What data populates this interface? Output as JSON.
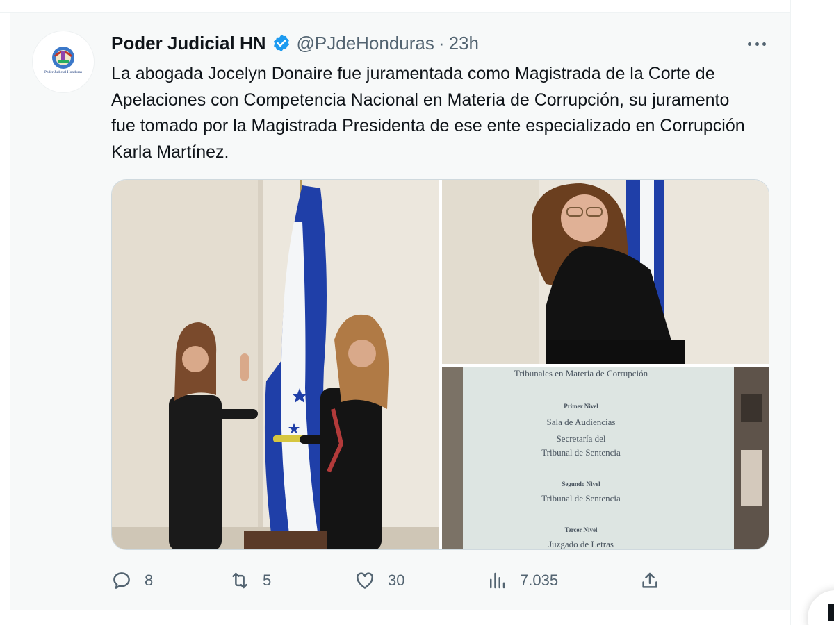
{
  "tweet": {
    "author_name": "Poder Judicial HN",
    "handle": "@PJdeHonduras",
    "separator": "·",
    "time": "23h",
    "text": "La abogada Jocelyn Donaire fue juramentada como Magistrada de la Corte de Apelaciones con Competencia Nacional en Materia de Corrupción, su juramento fue tomado por la Magistrada Presidenta de ese ente especializado en Corrupción Karla Martínez.",
    "avatar_caption": "Poder Judicial Honduras"
  },
  "photo3_sign": {
    "line1": "Tribunales en Materia de Corrupción",
    "line2": "Primer Nivel",
    "line3": "Sala de Audiencias",
    "line4": "Secretaría del",
    "line5": "Tribunal de Sentencia",
    "line6": "Segundo Nivel",
    "line7": "Tribunal de Sentencia",
    "line8": "Tercer Nivel",
    "line9": "Juzgado de Letras"
  },
  "actions": {
    "replies": "8",
    "retweets": "5",
    "likes": "30",
    "views": "7.035"
  },
  "colors": {
    "accent": "#1d9bf0",
    "muted": "#536471",
    "flag_blue": "#1f3fa8"
  },
  "icons": [
    "verified-badge-icon",
    "more-icon",
    "reply-icon",
    "retweet-icon",
    "like-icon",
    "views-icon",
    "share-icon"
  ]
}
